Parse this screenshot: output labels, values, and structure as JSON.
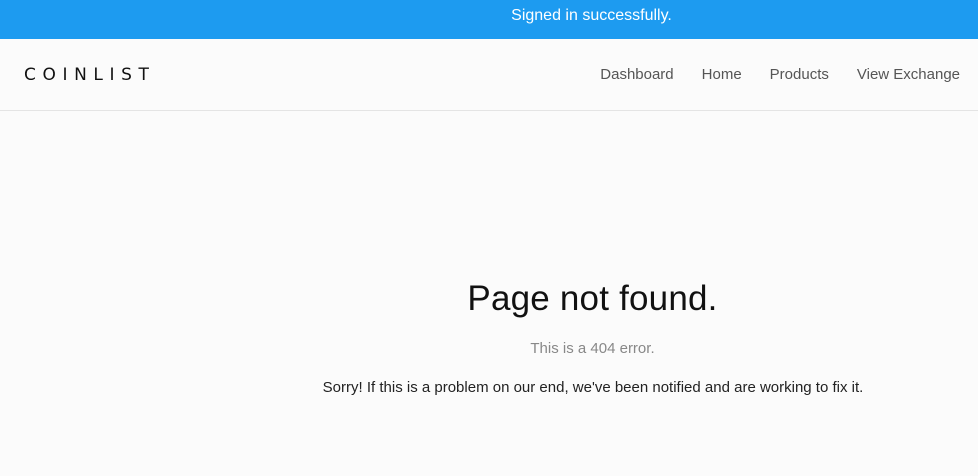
{
  "flash": {
    "message": "Signed in successfully."
  },
  "navbar": {
    "logo": "COINLIST",
    "links": [
      {
        "label": "Dashboard"
      },
      {
        "label": "Home"
      },
      {
        "label": "Products"
      },
      {
        "label": "View Exchange"
      }
    ]
  },
  "error_page": {
    "title": "Page not found.",
    "subtitle": "This is a 404 error.",
    "message": "Sorry! If this is a problem on our end, we've been notified and are working to fix it."
  },
  "colors": {
    "flash_background": "#1d9bf0",
    "page_background": "#fbfbfb"
  }
}
